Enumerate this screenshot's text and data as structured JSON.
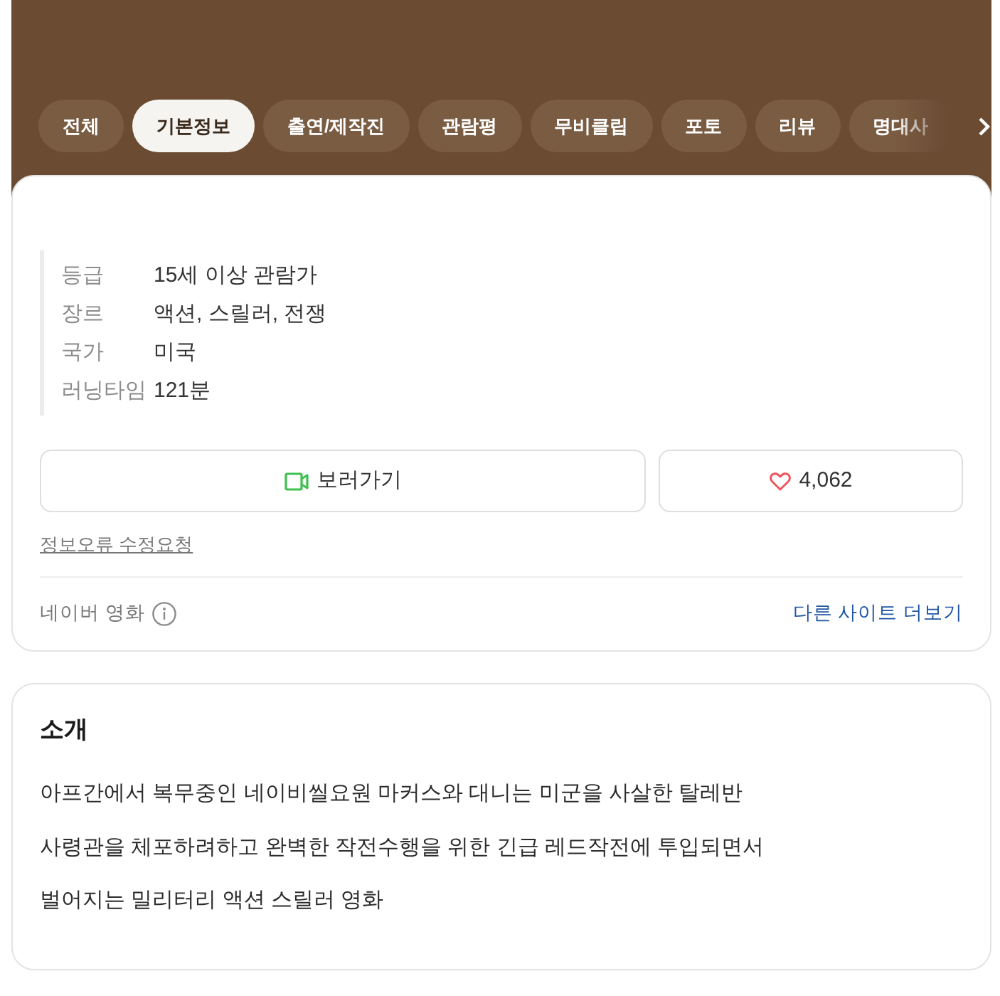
{
  "tabs": [
    {
      "label": "전체",
      "selected": false
    },
    {
      "label": "기본정보",
      "selected": true
    },
    {
      "label": "출연/제작진",
      "selected": false
    },
    {
      "label": "관람평",
      "selected": false
    },
    {
      "label": "무비클립",
      "selected": false
    },
    {
      "label": "포토",
      "selected": false
    },
    {
      "label": "리뷰",
      "selected": false
    },
    {
      "label": "명대사",
      "selected": false
    }
  ],
  "info": {
    "rows": [
      {
        "label": "등급",
        "value": "15세 이상 관람가"
      },
      {
        "label": "장르",
        "value": "액션, 스릴러, 전쟁"
      },
      {
        "label": "국가",
        "value": "미국"
      },
      {
        "label": "러닝타임",
        "value": "121분"
      }
    ]
  },
  "watch_button": {
    "label": "보러가기"
  },
  "like_button": {
    "count": "4,062",
    "liked": false
  },
  "report_link": "정보오류 수정요청",
  "source": {
    "label": "네이버 영화",
    "more_link": "다른 사이트 더보기"
  },
  "intro": {
    "title": "소개",
    "text": "아프간에서 복무중인 네이비씰요원 마커스와 대니는 미군을 사살한 탈레반\n사령관을 체포하려하고 완벽한 작전수행을 위한 긴급 레드작전에 투입되면서\n벌어지는 밀리터리 액션 스릴러 영화"
  }
}
